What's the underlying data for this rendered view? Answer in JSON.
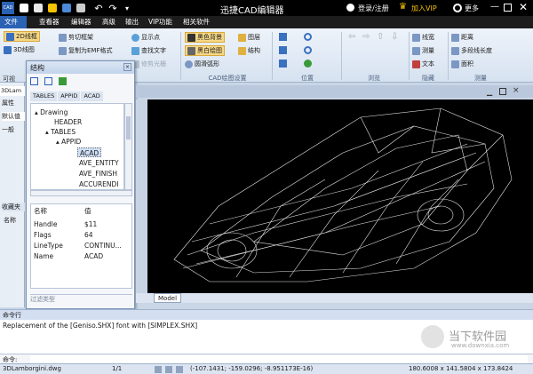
{
  "window": {
    "logo": "CAD",
    "title": "迅捷CAD编辑器",
    "login": "登录/注册",
    "vip": "加入VIP",
    "more": "更多",
    "colors": {
      "titlebar": "#000000",
      "accent": "#2a62b4",
      "vip": "#f5c400"
    }
  },
  "menu": [
    {
      "label": "文件",
      "active": true
    },
    {
      "label": "查看器"
    },
    {
      "label": "编辑器"
    },
    {
      "label": "高级"
    },
    {
      "label": "输出"
    },
    {
      "label": "VIP功能"
    },
    {
      "label": "相关软件"
    }
  ],
  "ribbon": {
    "btn_2d": "2D线框",
    "btn_3d": "3D线图",
    "btn_cut": "剪切框架",
    "btn_copy_emf": "复制为EMF格式",
    "btn_show_point": "显示点",
    "btn_find_text": "查找文字",
    "btn_trim": "修剪光栅",
    "btn_black_bg": "黑色背景",
    "btn_bw_draw": "黑白绘图",
    "btn_smooth_arc": "圆滑弧形",
    "btn_layer": "图层",
    "btn_structure": "结构",
    "grp_cad": "CAD绘图设置",
    "grp_position": "位置",
    "grp_browse": "浏览",
    "btn_linewidth": "线宽",
    "btn_measure": "测量",
    "btn_text": "文本",
    "grp_hide": "隐藏",
    "btn_distance": "距离",
    "btn_polyline_len": "多段线长度",
    "btn_area": "面积",
    "grp_measure": "测量"
  },
  "left_panel": {
    "tab": "3DLam",
    "props": "属性",
    "default": "默认值",
    "general": "一般",
    "visible": "可视",
    "favorites": "收藏夹",
    "name": "名称"
  },
  "structure": {
    "title": "结构",
    "tabs": [
      "TABLES",
      "APPID",
      "ACAD"
    ],
    "tree": [
      "Drawing",
      "HEADER",
      "TABLES",
      "APPID",
      "ACAD",
      "AVE_ENTITY",
      "AVE_FINISH",
      "ACCURENDI"
    ],
    "props_header": [
      "名称",
      "值"
    ],
    "props": [
      [
        "Handle",
        "$11"
      ],
      [
        "Flags",
        "64"
      ],
      [
        "LineType",
        "CONTINU..."
      ],
      [
        "Name",
        "ACAD"
      ]
    ],
    "filter": "过滤类型"
  },
  "model_tab": "Model",
  "command": {
    "label": "命令行",
    "output": "Replacement of the [Geniso.SHX] font with [SIMPLEX.SHX]",
    "input_label": "命令:"
  },
  "status": {
    "file": "3DLamborgini.dwg",
    "page": "1/1",
    "coords": "(-107.1431; -159.0296; -8.951173E-16)",
    "size": "180.6008 x 141.5804 x 173.8424"
  },
  "watermark": {
    "name": "当下软件园",
    "url": "www.downxia.com"
  }
}
